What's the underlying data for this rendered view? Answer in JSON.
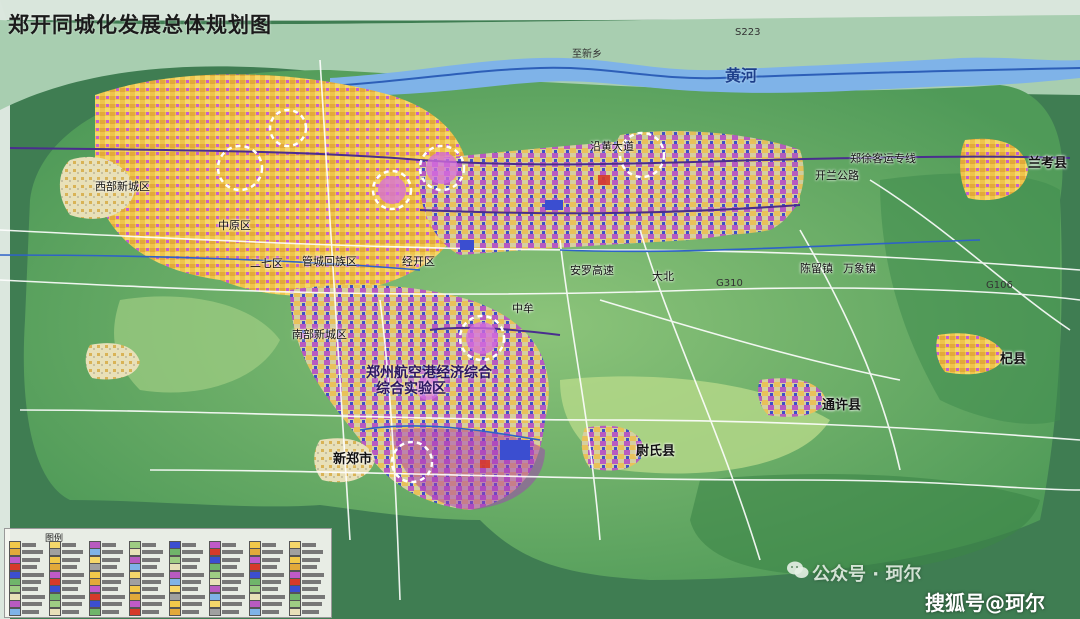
{
  "title": "郑开同城化发展总体规划图",
  "colors": {
    "river": "#7fb3e8",
    "urban_yellow": "#f1c84a",
    "urban_purple": "#c05ac8",
    "green_land": "#6fb56a",
    "dark_green": "#3d8a4a",
    "road": "#ffffff",
    "rail": "#4a2e8e"
  },
  "labels": {
    "river": "黄河",
    "north": "至新乡",
    "s223": "S223",
    "lankao": "兰考县",
    "xixin": "西部新城区",
    "zhongyuan": "中原区",
    "erqi": "二七区",
    "guancheng": "管城回族区",
    "kaifa": "经开区",
    "nanbu": "南部新城区",
    "airport_l1": "郑州航空港经济综合",
    "airport_l2": "综合实验区",
    "xinzheng": "新郑市",
    "weishi": "尉氏县",
    "tongxu": "通许县",
    "qixian": "杞县",
    "g106": "G106",
    "g310": "G310",
    "yanhuang": "沿黄大道",
    "zhengxu": "郑徐客运专线",
    "kailan": "开兰公路",
    "chenliu": "陈留镇",
    "dabei": "大北",
    "anluo": "安罗高速",
    "zhongmou": "中牟",
    "wanxiang": "万象镇",
    "legend_title": "图例"
  },
  "watermarks": {
    "gongzhonghao": "公众号 · 珂尔",
    "sohu": "搜狐号@珂尔"
  },
  "legend_rows": 10,
  "legend_cols": 8,
  "icons": [
    "wechat-icon"
  ]
}
